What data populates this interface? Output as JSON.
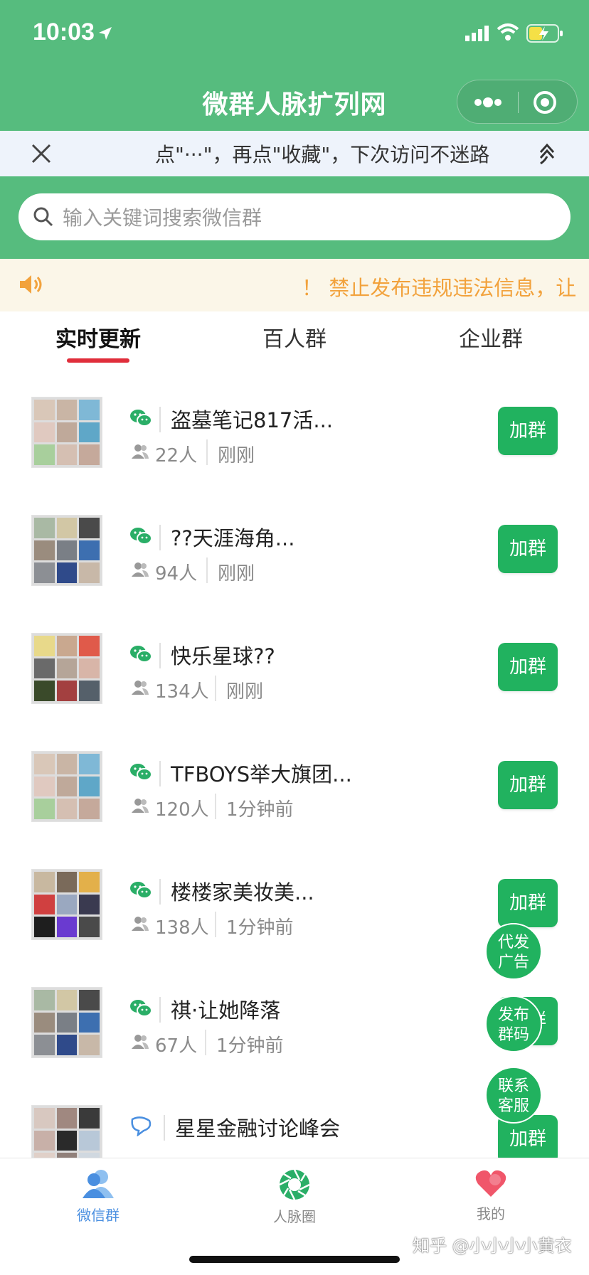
{
  "status_bar": {
    "time": "10:03"
  },
  "nav": {
    "title": "微群人脉扩列网",
    "more_icon": "more-dots-icon",
    "close_icon": "target-icon"
  },
  "tip_bar": {
    "text": "点\"···\"，再点\"收藏\"，下次访问不迷路"
  },
  "search": {
    "placeholder": "输入关键词搜索微信群"
  },
  "notice": {
    "text": "！ 禁止发布违规违法信息，让"
  },
  "tabs": [
    {
      "label": "实时更新",
      "active": true
    },
    {
      "label": "百人群",
      "active": false
    },
    {
      "label": "企业群",
      "active": false
    }
  ],
  "groups": [
    {
      "name": "盗墓笔记817活...",
      "count": "22人",
      "time": "刚刚",
      "join": "加群"
    },
    {
      "name": "??天涯海角...",
      "count": "94人",
      "time": "刚刚",
      "join": "加群"
    },
    {
      "name": "快乐星球??",
      "count": "134人",
      "time": "刚刚",
      "join": "加群"
    },
    {
      "name": "TFBOYS举大旗团...",
      "count": "120人",
      "time": "1分钟前",
      "join": "加群"
    },
    {
      "name": "楼楼家美妆美...",
      "count": "138人",
      "time": "1分钟前",
      "join": "加群"
    },
    {
      "name": "祺·让她降落",
      "count": "67人",
      "time": "1分钟前",
      "join": "加群"
    },
    {
      "name": "星星金融讨论峰会",
      "count": "",
      "time": "",
      "join": "加群"
    }
  ],
  "floating_buttons": [
    {
      "line1": "代发",
      "line2": "广告"
    },
    {
      "line1": "发布",
      "line2": "群码"
    },
    {
      "line1": "联系",
      "line2": "客服"
    }
  ],
  "tabbar": [
    {
      "label": "微信群",
      "icon": "people-icon",
      "active": true
    },
    {
      "label": "人脉圈",
      "icon": "aperture-icon",
      "active": false
    },
    {
      "label": "我的",
      "icon": "heart-icon",
      "active": false
    }
  ],
  "watermark": "知乎 @小小小小黄衣",
  "colors": {
    "brand_green": "#56bc7e",
    "button_green": "#21b25f",
    "accent_red": "#e02e3b",
    "notice_orange": "#f2a23c",
    "active_tab_blue": "#4a8fe0"
  }
}
